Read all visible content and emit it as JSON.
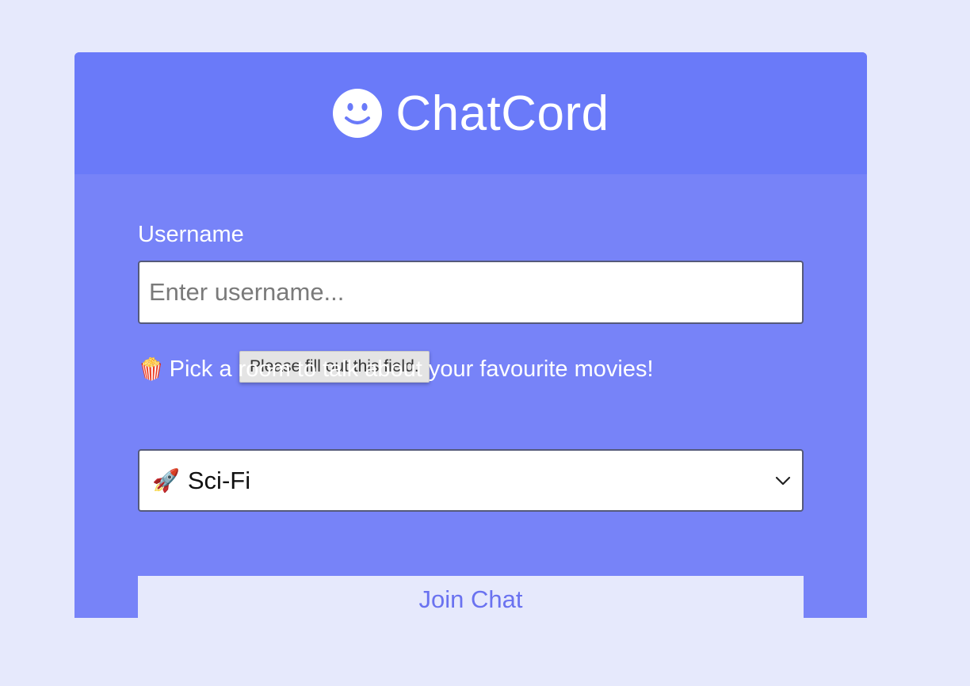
{
  "app": {
    "title": "ChatCord",
    "logo_icon": "smiley-face-icon"
  },
  "colors": {
    "page_background": "#e6e9fc",
    "header_background": "#6a7af9",
    "card_background": "#7783f8",
    "button_background": "#e6e9fc",
    "button_text": "#6a72f0"
  },
  "form": {
    "username_label": "Username",
    "username_placeholder": "Enter username...",
    "username_value": "",
    "validation_tooltip": "Please fill out this field.",
    "room_label_emoji": "🍿",
    "room_label": "Pick a room to talk about your favourite movies!",
    "room_selected_emoji": "🚀",
    "room_selected": "Sci-Fi",
    "join_button_label": "Join Chat"
  }
}
